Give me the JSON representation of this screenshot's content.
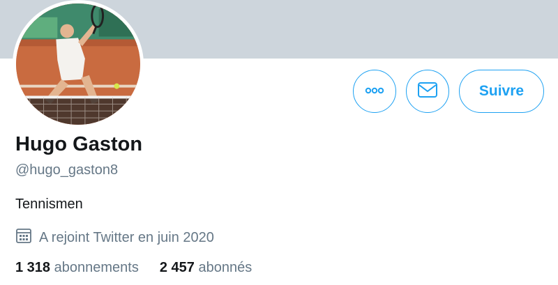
{
  "profile": {
    "name": "Hugo Gaston",
    "handle": "@hugo_gaston8",
    "bio": "Tennismen",
    "joined": "A rejoint Twitter en juin 2020"
  },
  "actions": {
    "more_icon": "more-icon",
    "message_icon": "envelope-icon",
    "follow_label": "Suivre"
  },
  "stats": {
    "following_count": "1 318",
    "following_label": "abonnements",
    "followers_count": "2 457",
    "followers_label": "abonnés"
  },
  "colors": {
    "accent": "#1da1f2",
    "banner": "#cdd5dc",
    "secondary_text": "#657786",
    "primary_text": "#14171a"
  }
}
